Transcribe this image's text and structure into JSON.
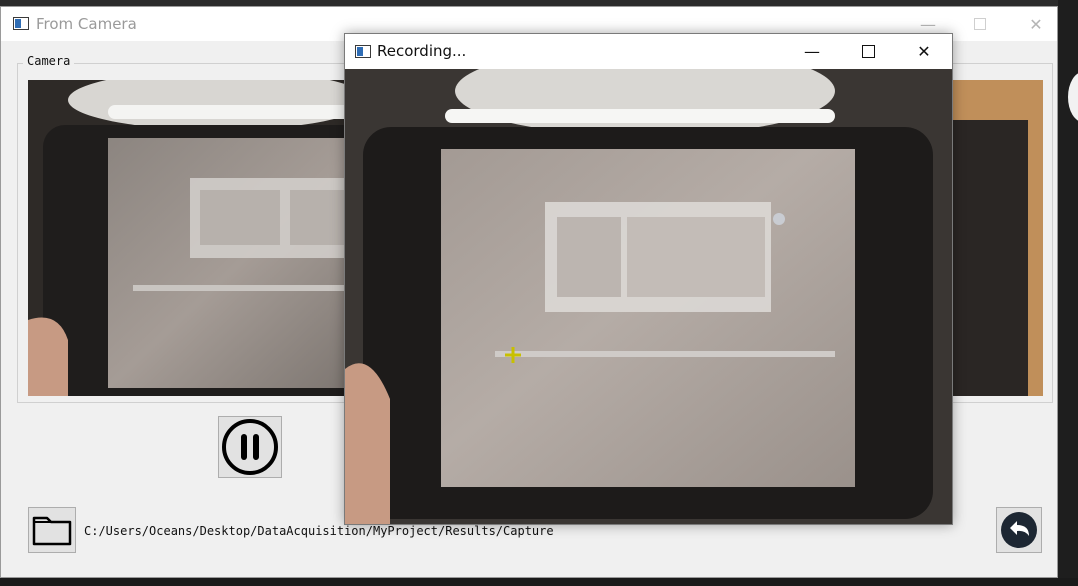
{
  "main_window": {
    "title": "From Camera",
    "controls": {
      "minimize": "—",
      "maximize": "",
      "close": "✕"
    },
    "camera_group": {
      "label": "Camera"
    },
    "pause_button": {
      "icon": "pause-circle-icon"
    },
    "folder_button": {
      "icon": "folder-icon"
    },
    "save_path": "C:/Users/Oceans/Desktop/DataAcquisition/MyProject/Results/Capture",
    "back_button": {
      "icon": "undo-arrow-icon"
    }
  },
  "recording_window": {
    "title": "Recording...",
    "controls": {
      "minimize": "—",
      "maximize": "",
      "close": "✕"
    },
    "crosshair_color": "#c8c000"
  },
  "colors": {
    "window_bg": "#f0f0f0",
    "titlebar_bg": "#ffffff",
    "inactive_title": "#9a9a9a",
    "app_icon_blue": "#2f6db5"
  }
}
